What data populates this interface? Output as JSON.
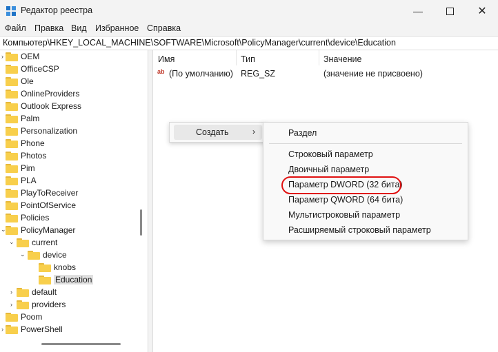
{
  "window": {
    "title": "Редактор реестра",
    "minimize_icon": "minimize-icon",
    "maximize_icon": "maximize-icon",
    "close_icon": "close-icon"
  },
  "menu": [
    "Файл",
    "Правка",
    "Вид",
    "Избранное",
    "Справка"
  ],
  "address": "Компьютер\\HKEY_LOCAL_MACHINE\\SOFTWARE\\Microsoft\\PolicyManager\\current\\device\\Education",
  "tree": [
    {
      "label": "OEM"
    },
    {
      "label": "OfficeCSP"
    },
    {
      "label": "Ole"
    },
    {
      "label": "OnlineProviders"
    },
    {
      "label": "Outlook Express"
    },
    {
      "label": "Palm"
    },
    {
      "label": "Personalization"
    },
    {
      "label": "Phone"
    },
    {
      "label": "Photos"
    },
    {
      "label": "Pim"
    },
    {
      "label": "PLA"
    },
    {
      "label": "PlayToReceiver"
    },
    {
      "label": "PointOfService"
    },
    {
      "label": "Policies"
    },
    {
      "label": "PolicyManager"
    },
    {
      "label": "current"
    },
    {
      "label": "device"
    },
    {
      "label": "knobs"
    },
    {
      "label": "Education"
    },
    {
      "label": "default"
    },
    {
      "label": "providers"
    },
    {
      "label": "Poom"
    },
    {
      "label": "PowerShell"
    }
  ],
  "columns": {
    "name": "Имя",
    "type": "Тип",
    "value": "Значение"
  },
  "rows": [
    {
      "name": "(По умолчанию)",
      "type": "REG_SZ",
      "value": "(значение не присвоено)",
      "icon": "string-value-icon"
    }
  ],
  "context_menu": {
    "create": "Создать",
    "submenu": [
      "Раздел",
      "Строковый параметр",
      "Двоичный параметр",
      "Параметр DWORD (32 бита)",
      "Параметр QWORD (64 бита)",
      "Мультистроковый параметр",
      "Расширяемый строковый параметр"
    ]
  },
  "highlight_color": "#e01010"
}
